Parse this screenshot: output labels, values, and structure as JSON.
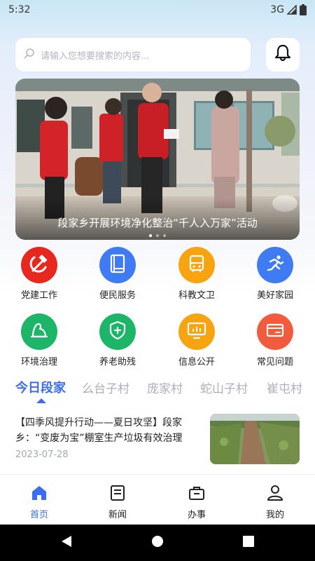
{
  "status_bar": {
    "time": "5:32",
    "network": "3G"
  },
  "search": {
    "placeholder": "请输入您想要搜索的内容..."
  },
  "banner": {
    "caption": "段家乡开展环境净化整治“千人入万家”活动",
    "dot_count": 3,
    "active_dot": 0
  },
  "services": [
    {
      "label": "党建工作",
      "icon": "hammer-sickle-icon",
      "color": "#e8281f"
    },
    {
      "label": "便民服务",
      "icon": "book-icon",
      "color": "#3f7cf4"
    },
    {
      "label": "科教文卫",
      "icon": "bus-icon",
      "color": "#f8a310"
    },
    {
      "label": "美好家园",
      "icon": "running-icon",
      "color": "#3f7cf4"
    },
    {
      "label": "环境治理",
      "icon": "mountain-icon",
      "color": "#1db668"
    },
    {
      "label": "养老助残",
      "icon": "shield-plus-icon",
      "color": "#1db668"
    },
    {
      "label": "信息公开",
      "icon": "monitor-chart-icon",
      "color": "#f8a310"
    },
    {
      "label": "常见问题",
      "icon": "card-icon",
      "color": "#f25b3d"
    }
  ],
  "tabs": [
    "今日段家",
    "么台子村",
    "庞家村",
    "蛇山子村",
    "崔屯村"
  ],
  "active_tab": 0,
  "news": [
    {
      "title": "【四季风提升行动——夏日攻坚】段家乡：“变废为宝”棚室生产垃圾有效治理",
      "date": "2023-07-28"
    }
  ],
  "bottom_nav": [
    {
      "label": "首页",
      "icon": "home-icon"
    },
    {
      "label": "新闻",
      "icon": "news-icon"
    },
    {
      "label": "办事",
      "icon": "briefcase-icon"
    },
    {
      "label": "我的",
      "icon": "user-icon"
    }
  ],
  "active_nav": 0,
  "colors": {
    "accent": "#3b6cf3"
  }
}
